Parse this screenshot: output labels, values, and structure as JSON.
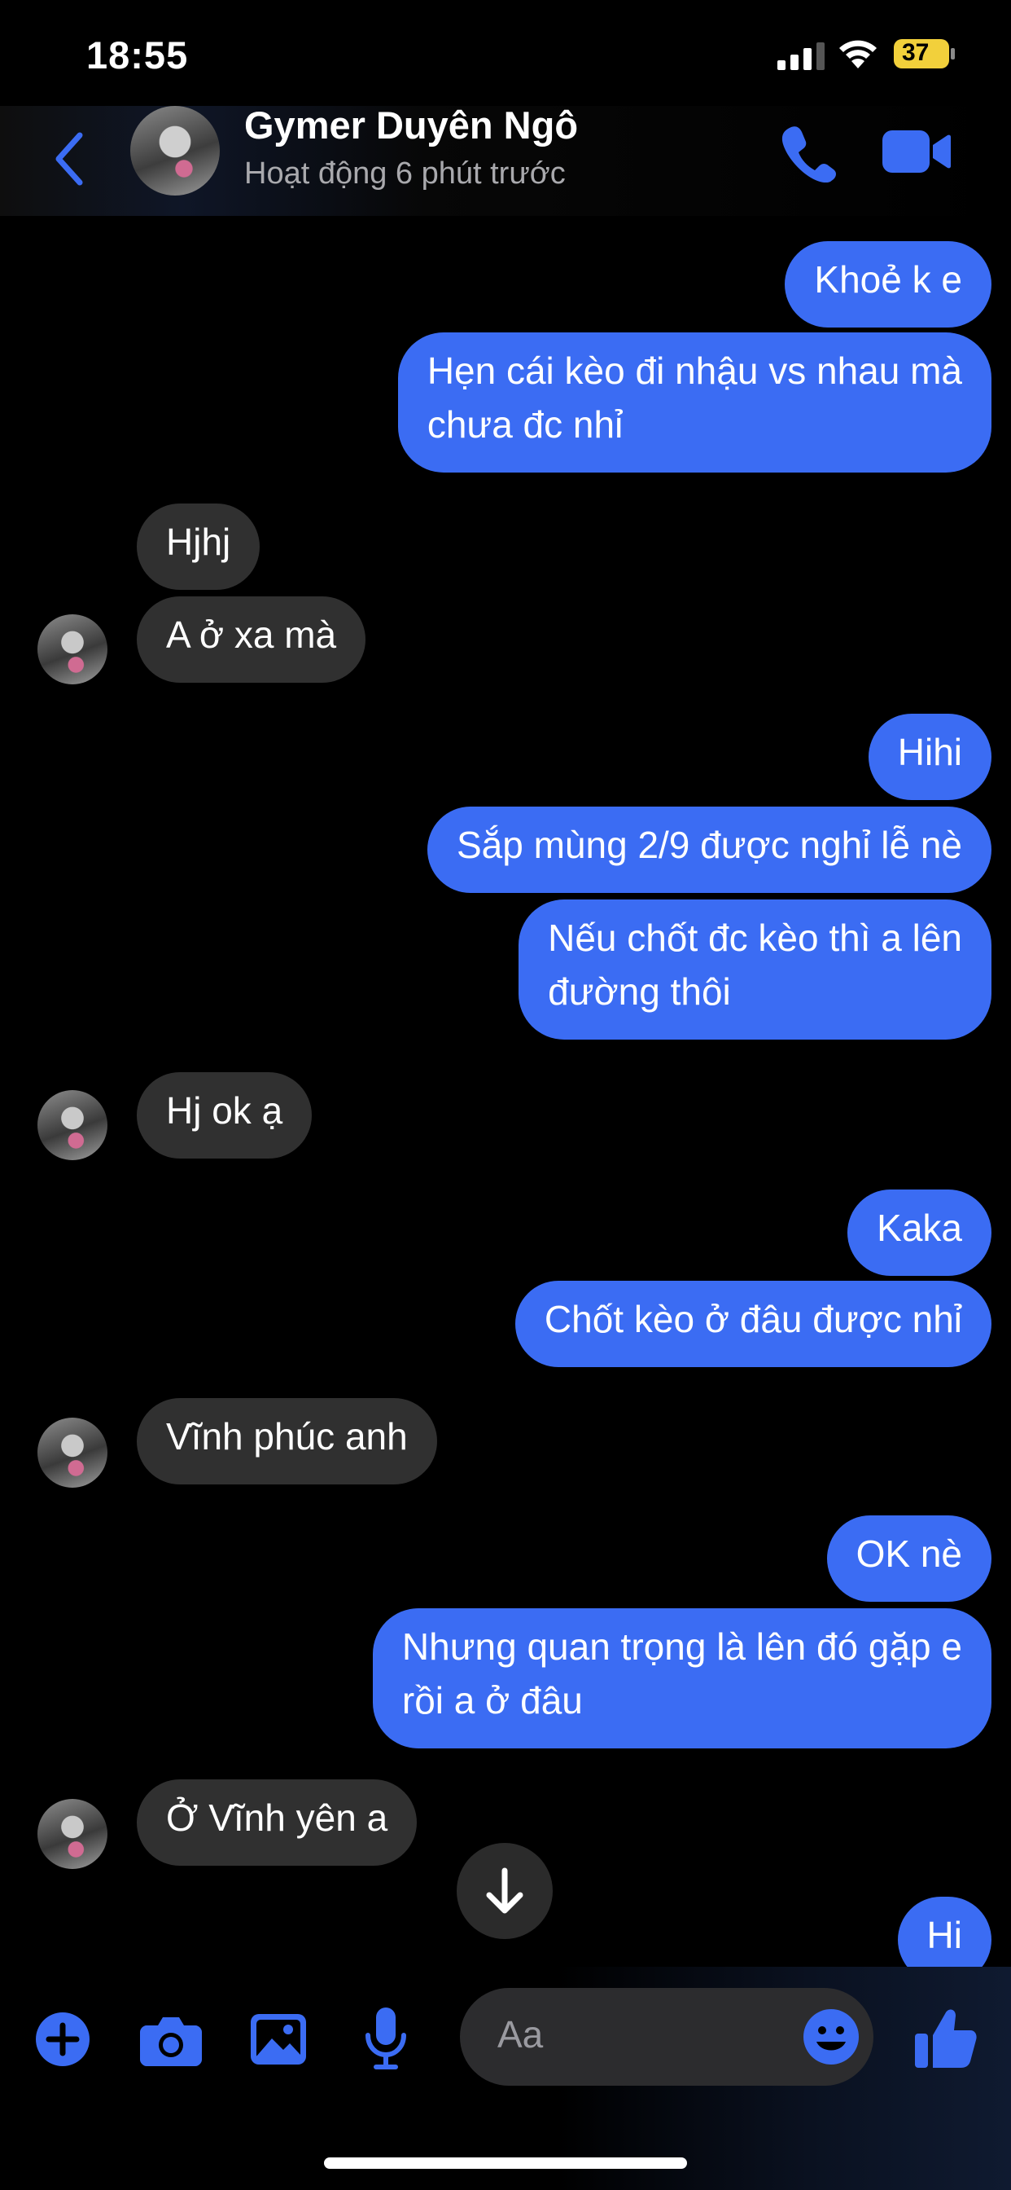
{
  "status_bar": {
    "time": "18:55",
    "battery": "37"
  },
  "header": {
    "name": "Gymer Duyên Ngô",
    "status": "Hoạt động 6 phút trước",
    "accent": "#3b6cf3"
  },
  "messages": [
    {
      "from": "me",
      "text": "Khoẻ k e"
    },
    {
      "from": "me",
      "lines": [
        "Hẹn cái kèo đi nhậu vs nhau mà",
        "chưa đc nhỉ"
      ]
    },
    {
      "from": "them",
      "text": "Hjhj"
    },
    {
      "from": "them",
      "text": "A ở xa mà"
    },
    {
      "from": "me",
      "text": "Hihi"
    },
    {
      "from": "me",
      "text": "Sắp mùng 2/9 được nghỉ lễ nè"
    },
    {
      "from": "me",
      "lines": [
        "Nếu chốt đc kèo thì a lên",
        "đường thôi"
      ]
    },
    {
      "from": "them",
      "text": "Hj ok ạ"
    },
    {
      "from": "me",
      "text": "Kaka"
    },
    {
      "from": "me",
      "text": "Chốt kèo ở đâu được nhỉ"
    },
    {
      "from": "them",
      "text": "Vĩnh phúc anh"
    },
    {
      "from": "me",
      "text": "OK nè"
    },
    {
      "from": "me",
      "lines": [
        "Nhưng quan trọng là lên đó gặp e",
        "rồi a ở đâu"
      ]
    },
    {
      "from": "them",
      "text": "Ở Vĩnh yên a"
    },
    {
      "from": "me",
      "text": "Hi"
    }
  ],
  "composer": {
    "placeholder": "Aa"
  },
  "colors": {
    "outgoing_bubble": "#3b6cf3",
    "incoming_bubble": "#303030",
    "background": "#000000"
  },
  "icons": [
    "back-chevron-icon",
    "phone-icon",
    "video-camera-icon",
    "scroll-down-arrow-icon",
    "plus-icon",
    "camera-icon",
    "image-icon",
    "microphone-icon",
    "emoji-icon",
    "thumbs-up-icon"
  ]
}
